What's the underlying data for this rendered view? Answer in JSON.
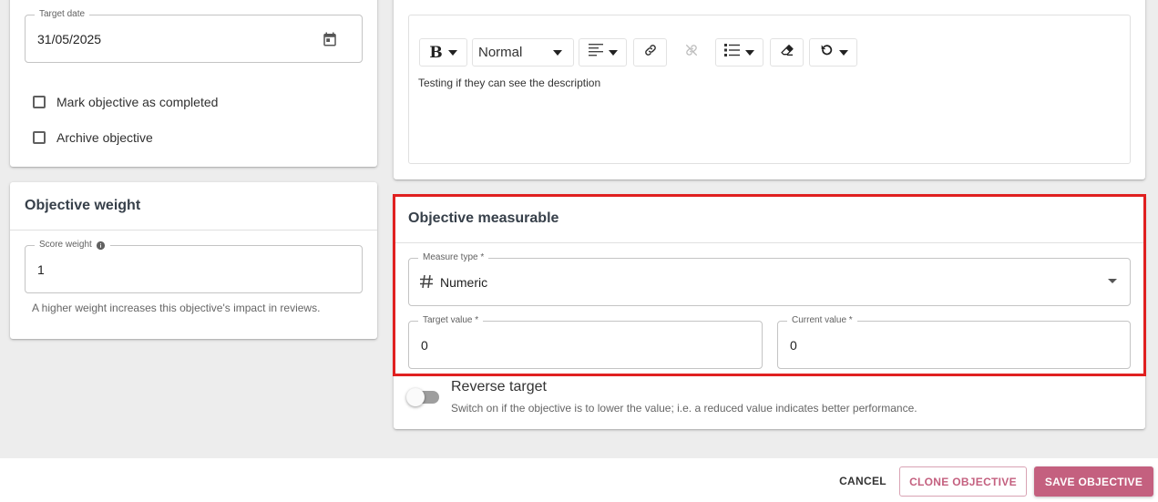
{
  "target_date": {
    "label": "Target date",
    "value": "31/05/2025"
  },
  "status_options": {
    "mark_completed": "Mark objective as completed",
    "archive": "Archive objective"
  },
  "weight": {
    "title": "Objective weight",
    "score_label": "Score weight",
    "score_value": "1",
    "helper": "A higher weight increases this objective's impact in reviews."
  },
  "editor": {
    "format_value": "Normal",
    "content": "Testing if they can see the description"
  },
  "measurable": {
    "title": "Objective measurable",
    "measure_type_label": "Measure type *",
    "measure_type_value": "Numeric",
    "target_label": "Target value *",
    "target_value": "0",
    "current_label": "Current value *",
    "current_value": "0"
  },
  "reverse_target": {
    "title": "Reverse target",
    "description": "Switch on if the objective is to lower the value; i.e. a reduced value indicates better performance.",
    "on": false
  },
  "footer": {
    "cancel": "CANCEL",
    "clone": "CLONE OBJECTIVE",
    "save": "SAVE OBJECTIVE"
  },
  "colors": {
    "accent": "#c4607f",
    "highlight": "#e02020"
  },
  "icons": {
    "calendar": "calendar-icon",
    "info": "info-icon",
    "hash": "hash-icon",
    "bold": "bold-icon",
    "align": "align-left-icon",
    "link": "link-icon",
    "unlink": "unlink-icon",
    "list": "bullet-list-icon",
    "eraser": "eraser-icon",
    "undo": "undo-icon"
  }
}
